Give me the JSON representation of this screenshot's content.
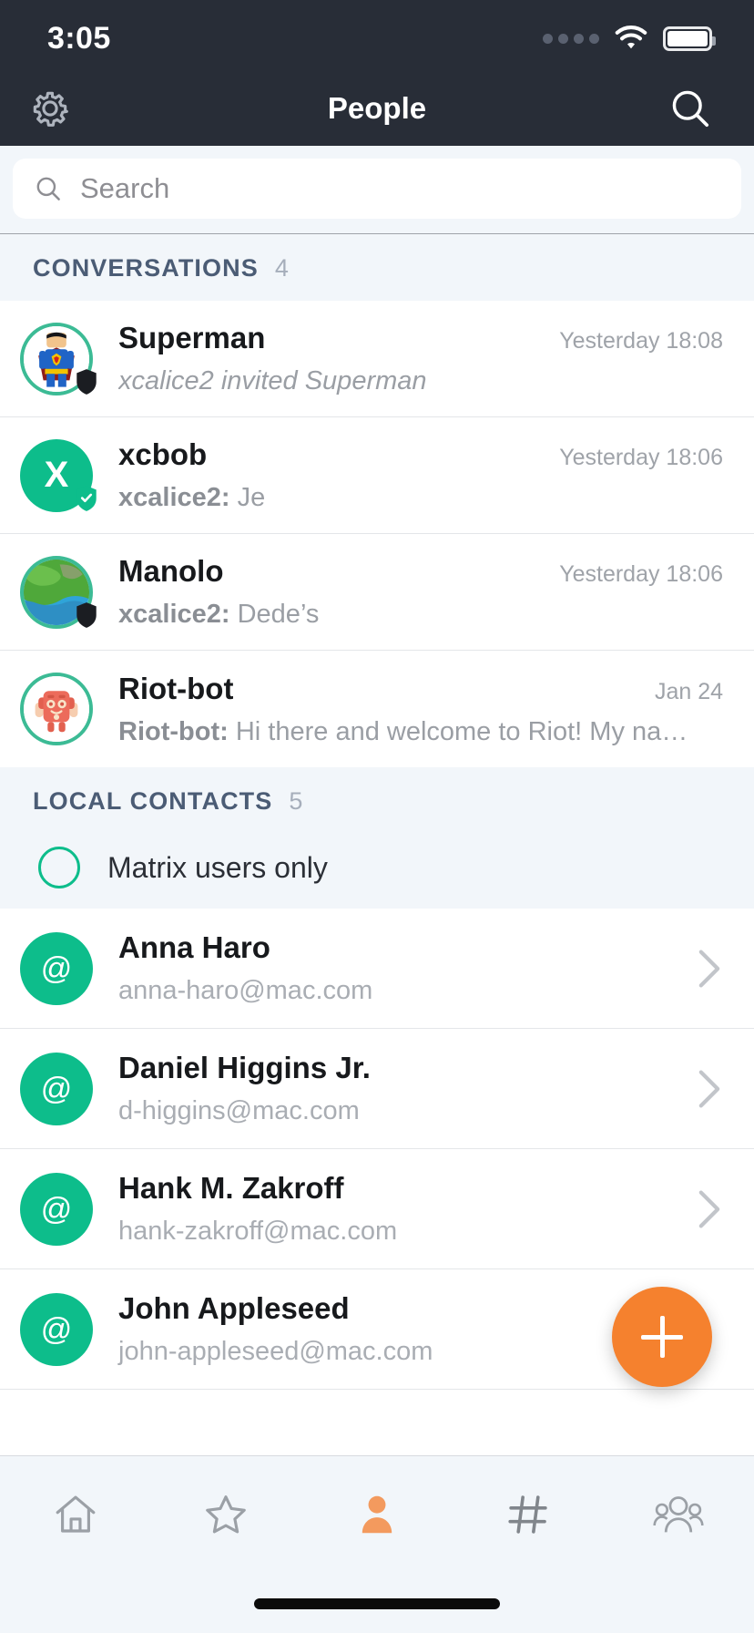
{
  "status_bar": {
    "time": "3:05",
    "signal_icon": "signal-dots-icon",
    "wifi_icon": "wifi-icon",
    "battery_icon": "battery-full-icon"
  },
  "nav_bar": {
    "title": "People",
    "settings_icon": "gear-icon",
    "search_icon": "search-icon"
  },
  "search": {
    "placeholder": "Search",
    "value": "",
    "icon": "search-icon"
  },
  "sections": {
    "conversations": {
      "title": "CONVERSATIONS",
      "count": "4"
    },
    "local_contacts": {
      "title": "LOCAL CONTACTS",
      "count": "5"
    }
  },
  "filter": {
    "label": "Matrix users only",
    "checked": false,
    "icon": "radio-unchecked-icon"
  },
  "conversations": [
    {
      "name": "Superman",
      "time": "Yesterday 18:08",
      "preview_sender": "",
      "preview": "xcalice2 invited Superman",
      "italic": true,
      "avatar_kind": "image-superman",
      "badge": "shield-dark-icon"
    },
    {
      "name": "xcbob",
      "time": "Yesterday 18:06",
      "preview_sender": "xcalice2:",
      "preview": "Je",
      "italic": false,
      "avatar_kind": "letter",
      "avatar_letter": "X",
      "badge": "shield-check-green-icon"
    },
    {
      "name": "Manolo",
      "time": "Yesterday 18:06",
      "preview_sender": "xcalice2:",
      "preview": "Dede’s",
      "italic": false,
      "avatar_kind": "image-earth",
      "badge": "shield-dark-icon"
    },
    {
      "name": "Riot-bot",
      "time": "Jan 24",
      "preview_sender": "Riot-bot:",
      "preview": "Hi there and welcome to Riot! My na…",
      "italic": false,
      "avatar_kind": "image-robot",
      "badge": ""
    }
  ],
  "contacts": [
    {
      "name": "Anna Haro",
      "email": "anna-haro@mac.com",
      "avatar_glyph": "@",
      "chevron": "chevron-right-icon"
    },
    {
      "name": "Daniel Higgins Jr.",
      "email": "d-higgins@mac.com",
      "avatar_glyph": "@",
      "chevron": "chevron-right-icon"
    },
    {
      "name": "Hank M. Zakroff",
      "email": "hank-zakroff@mac.com",
      "avatar_glyph": "@",
      "chevron": "chevron-right-icon"
    },
    {
      "name": "John Appleseed",
      "email": "john-appleseed@mac.com",
      "avatar_glyph": "@",
      "chevron": "chevron-right-icon"
    }
  ],
  "fab": {
    "label": "+",
    "icon": "plus-icon"
  },
  "tab_bar": {
    "active_index": 2,
    "tabs": [
      {
        "name": "home",
        "icon": "home-icon"
      },
      {
        "name": "favourites",
        "icon": "star-icon"
      },
      {
        "name": "people",
        "icon": "person-icon"
      },
      {
        "name": "rooms",
        "icon": "hash-icon"
      },
      {
        "name": "groups",
        "icon": "people-group-icon"
      }
    ]
  },
  "colors": {
    "nav_background": "#282D37",
    "accent_green": "#0DBD8B",
    "accent_orange": "#F5812E",
    "section_background": "#F2F6FA",
    "text_primary": "#17191C",
    "text_secondary": "#9FA3A9"
  }
}
